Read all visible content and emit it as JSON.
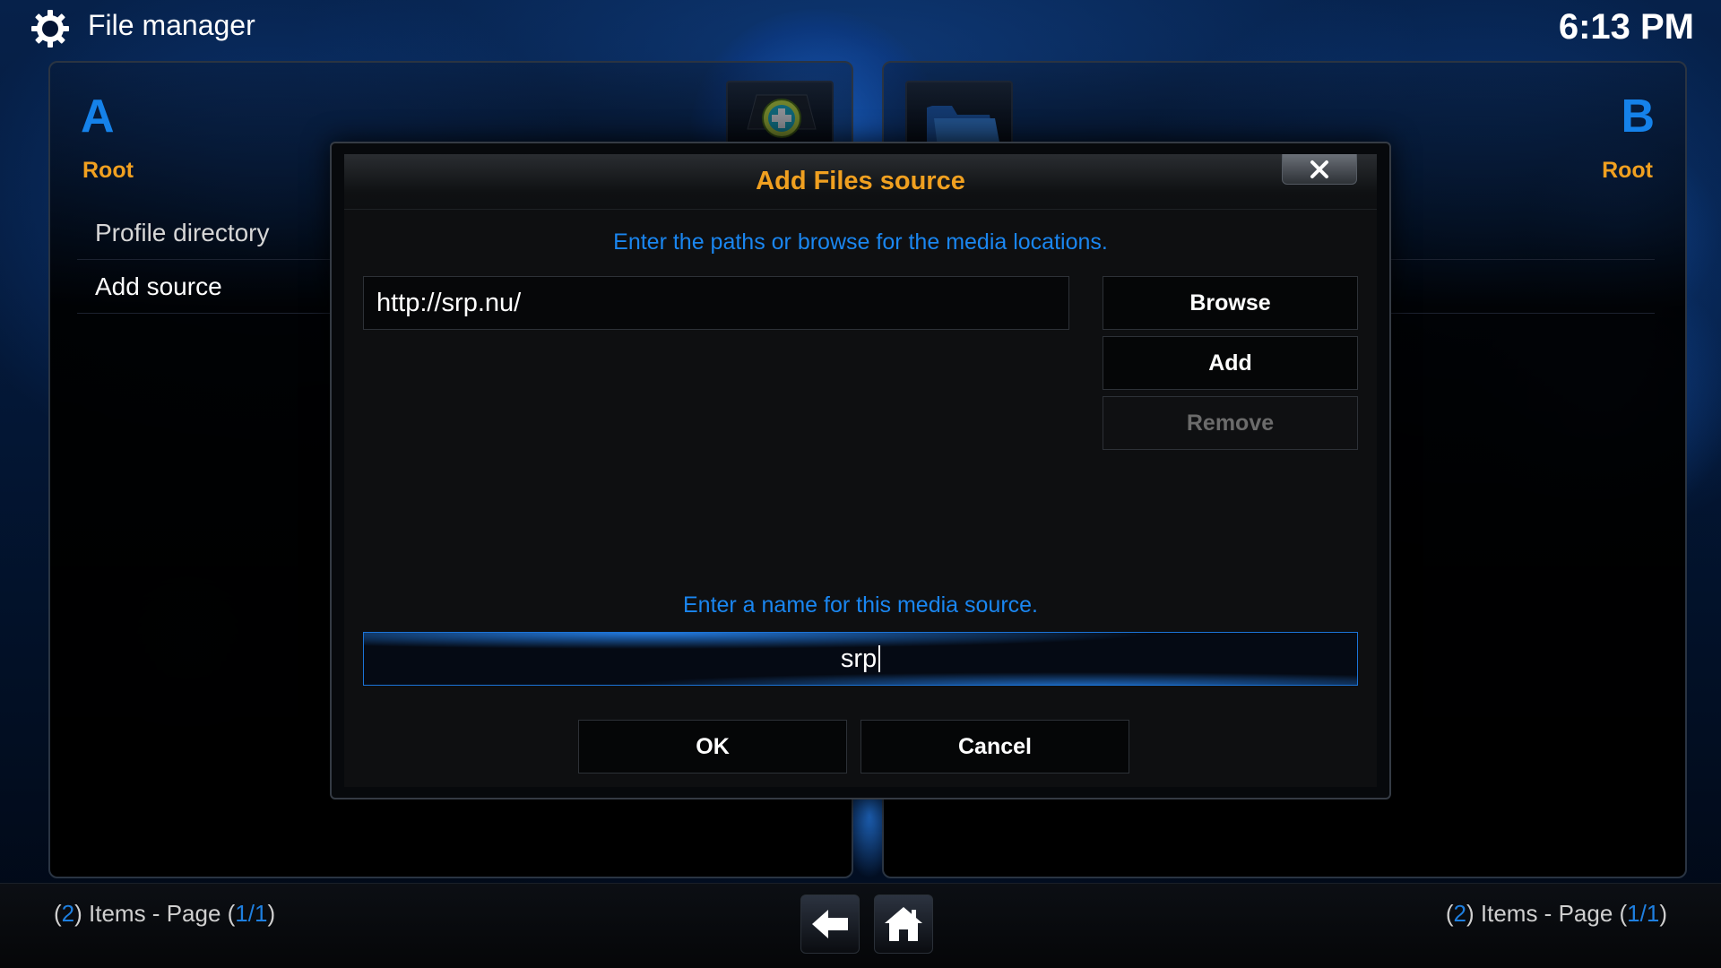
{
  "header": {
    "title": "File manager",
    "clock": "6:13 PM",
    "settings_icon": "gear-icon"
  },
  "pane_a": {
    "letter": "A",
    "location": "Root",
    "items": [
      {
        "label": "Profile directory"
      },
      {
        "label": "Add source"
      }
    ],
    "footer": {
      "prefix": "(",
      "count": "2",
      "mid": ") Items - Page (",
      "page": "1/1",
      "suffix": ")"
    }
  },
  "pane_b": {
    "letter": "B",
    "location": "Root",
    "footer": {
      "prefix": "(",
      "count": "2",
      "mid": ") Items - Page (",
      "page": "1/1",
      "suffix": ")"
    }
  },
  "top_icons": {
    "add": "add-source-icon",
    "folder": "folder-icon"
  },
  "footer_nav": {
    "back_icon": "back-arrow-icon",
    "home_icon": "home-icon"
  },
  "dialog": {
    "title": "Add Files source",
    "paths_hint": "Enter the paths or browse for the media locations.",
    "path_value": "http://srp.nu/",
    "browse_label": "Browse",
    "add_label": "Add",
    "remove_label": "Remove",
    "name_hint": "Enter a name for this media source.",
    "name_value": "srp",
    "ok_label": "OK",
    "cancel_label": "Cancel",
    "close_icon": "close-icon"
  },
  "colors": {
    "accent_blue": "#1582ea",
    "accent_orange": "#f0a020"
  }
}
